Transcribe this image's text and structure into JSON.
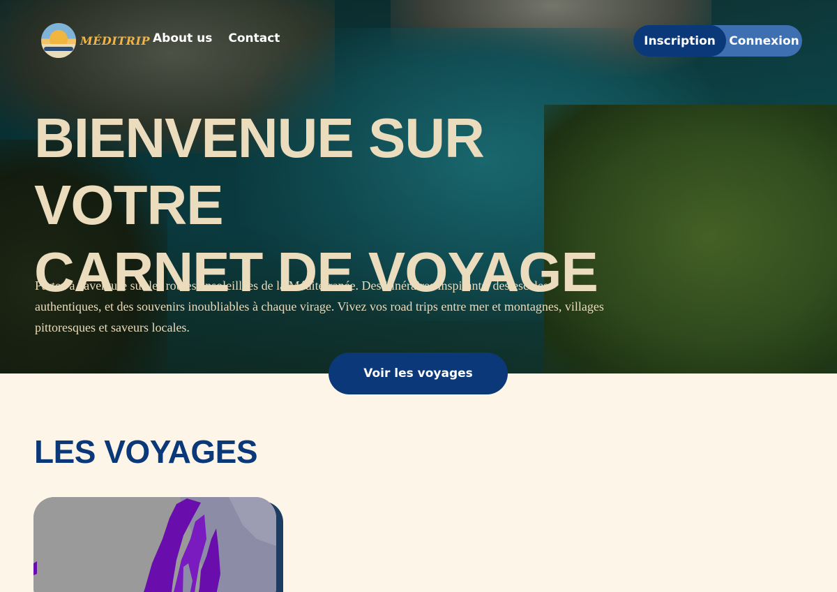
{
  "brand": {
    "name": "MÉDITRIP"
  },
  "nav": {
    "links": [
      "About us",
      "Contact"
    ]
  },
  "auth": {
    "signup": "Inscription",
    "login": "Connexion"
  },
  "hero": {
    "title_line1": "BIENVENUE SUR VOTRE",
    "title_line2": "CARNET DE VOYAGE",
    "subtitle": "Partez à l'aventure sur les routes ensoleillées de la Méditerranée. Des itinéraires inspirants, des escales authentiques, et des souvenirs inoubliables à chaque virage. Vivez vos road trips entre mer et montagnes, villages pittoresques et saveurs locales.",
    "cta": "Voir les voyages"
  },
  "trips": {
    "heading": "LES VOYAGES"
  },
  "colors": {
    "primary": "#0b3878",
    "secondary": "#3e6fb0",
    "cream": "#fdf5e8",
    "hero_text": "#eadcbc",
    "logo_gold": "#f2b446",
    "map_highlight": "#6a0dad"
  },
  "icons": {
    "logo": "sun-over-sea-logo-icon"
  }
}
